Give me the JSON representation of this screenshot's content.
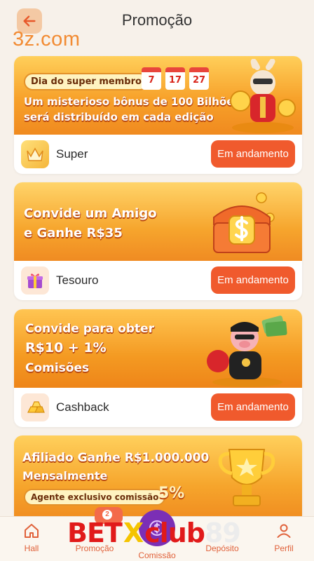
{
  "header": {
    "title": "Promoção",
    "watermark": "3z.com"
  },
  "cards": [
    {
      "label": "Super",
      "status": "Em andamento",
      "banner": {
        "pill": "Dia do super membro",
        "dates": [
          "7",
          "17",
          "27"
        ],
        "line1": "Um misterioso bônus de 100 Bilhões",
        "line2": "será distribuído em cada edição"
      }
    },
    {
      "label": "Tesouro",
      "status": "Em andamento",
      "banner": {
        "line1": "Convide um Amigo",
        "line2": "e Ganhe R$35"
      }
    },
    {
      "label": "Cashback",
      "status": "Em andamento",
      "banner": {
        "line1": "Convide para obter",
        "line2": "R$10 + 1%",
        "line3": "Comisões"
      }
    },
    {
      "banner": {
        "line1": "Afiliado Ganhe R$1.000.000",
        "line2": "Mensalmente",
        "pill": "Agente exclusivo comissão",
        "percent": "5%"
      }
    }
  ],
  "nav": {
    "items": [
      {
        "label": "Hall"
      },
      {
        "label": "Promoção",
        "badge": "2"
      },
      {
        "label": "Comissão"
      },
      {
        "label": "Depósito"
      },
      {
        "label": "Perfil"
      }
    ]
  },
  "overlay_logo": {
    "bet": "BET",
    "x": "X",
    "club": "club",
    "num": "89"
  },
  "colors": {
    "accent": "#f05a2d",
    "banner_orange": "#f5a623",
    "background": "#f7f1ea"
  }
}
